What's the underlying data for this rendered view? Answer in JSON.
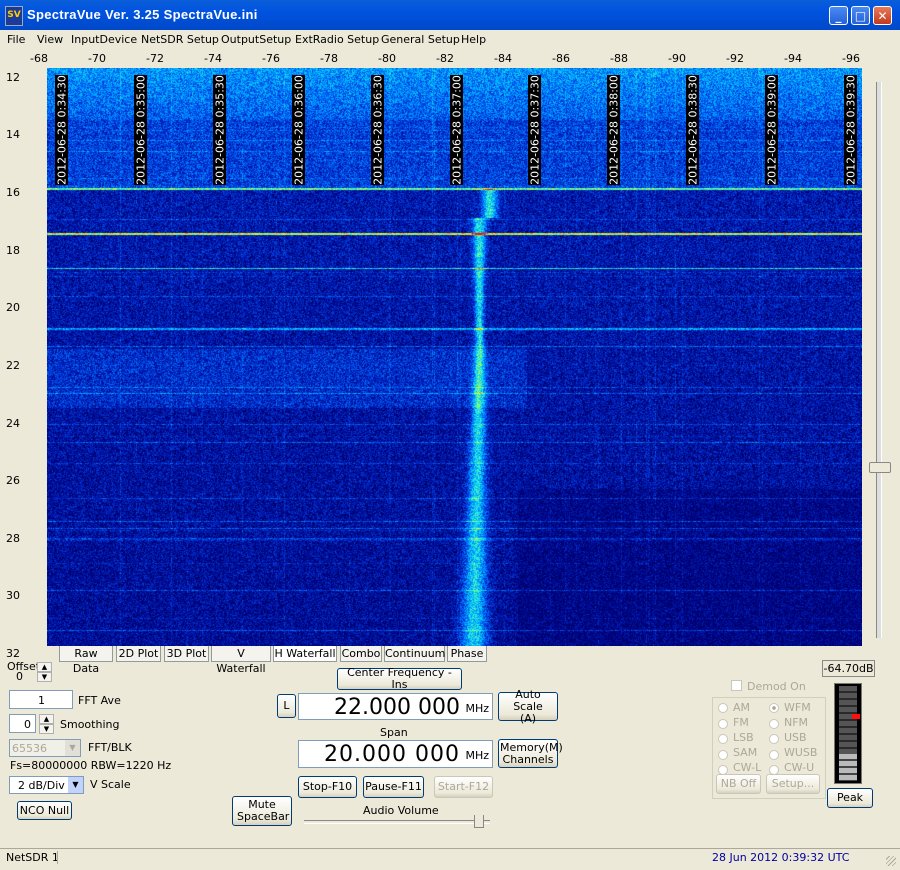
{
  "window": {
    "title": "SpectraVue Ver. 3.25  SpectraVue.ini",
    "icon": "SV"
  },
  "menu": [
    "File",
    "View",
    "InputDevice",
    "NetSDR Setup",
    "OutputSetup",
    "ExtRadio Setup",
    "General Setup",
    "Help"
  ],
  "freq_axis": [
    "-68",
    "-70",
    "-72",
    "-74",
    "-76",
    "-78",
    "-80",
    "-82",
    "-84",
    "-86",
    "-88",
    "-90",
    "-92",
    "-94",
    "-96"
  ],
  "y_axis": [
    "12",
    "14",
    "16",
    "18",
    "20",
    "22",
    "24",
    "26",
    "28",
    "30",
    "32"
  ],
  "timestamps": [
    "2012-06-28 0:34:30",
    "2012-06-28 0:35:00",
    "2012-06-28 0:35:30",
    "2012-06-28 0:36:00",
    "2012-06-28 0:36:30",
    "2012-06-28 0:37:00",
    "2012-06-28 0:37:30",
    "2012-06-28 0:38:00",
    "2012-06-28 0:38:30",
    "2012-06-28 0:39:00",
    "2012-06-28 0:39:30"
  ],
  "tabs": [
    "Raw Data",
    "2D Plot",
    "3D Plot",
    "V Waterfall",
    "H Waterfall",
    "Combo",
    "Continuum",
    "Phase"
  ],
  "active_tab": "H Waterfall",
  "left_panel": {
    "offset_label": "Offset",
    "offset_value": "0",
    "fft_ave_value": "1",
    "fft_ave_label": "FFT Ave",
    "smoothing_value": "0",
    "smoothing_label": "Smoothing",
    "fft_blk_value": "65536",
    "fft_blk_label": "FFT/BLK",
    "fs_text": "Fs=80000000 RBW=1220 Hz",
    "vscale_value": "2 dB/Div",
    "vscale_label": "V Scale",
    "nco_null": "NCO Null"
  },
  "center": {
    "center_freq_button": "Center Frequency - Ins",
    "l_button": "L",
    "center_value": "22.000 000",
    "mhz": "MHz",
    "auto_scale": "Auto Scale (A)",
    "span_label": "Span",
    "span_value": "20.000 000",
    "memory_button": "Memory(M) Channels",
    "mute_button": "Mute SpaceBar",
    "stop_button": "Stop-F10",
    "pause_button": "Pause-F11",
    "start_button": "Start-F12",
    "audio_volume": "Audio Volume"
  },
  "demod": {
    "checkbox_label": "Demod On",
    "modes_left": [
      "AM",
      "FM",
      "LSB",
      "SAM",
      "CW-L"
    ],
    "modes_right": [
      "WFM",
      "NFM",
      "USB",
      "WUSB",
      "CW-U"
    ],
    "selected": "WFM",
    "nb_off": "NB Off",
    "setup": "Setup..."
  },
  "meter": {
    "value": "-64.70dB",
    "peak_button": "Peak",
    "level": 0.28
  },
  "status": {
    "left": "NetSDR 1",
    "right": "28 Jun 2012   0:39:32 UTC"
  },
  "colors": {
    "titlebar": "#0053e0",
    "background": "#ece9d8",
    "waterfall_base": "#00107a",
    "status_blue": "#0000a0"
  }
}
